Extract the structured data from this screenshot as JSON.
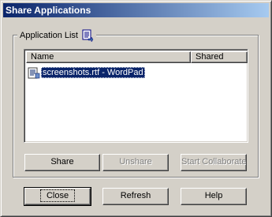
{
  "window": {
    "title": "Share Applications"
  },
  "group": {
    "label": "Application List",
    "icon": "shared-list-icon"
  },
  "list": {
    "columns": [
      "Name",
      "Shared"
    ],
    "rows": [
      {
        "name": "screenshots.rtf - WordPad",
        "shared": "",
        "selected": true,
        "icon": "wordpad-document-icon"
      }
    ]
  },
  "list_buttons": {
    "share": "Share",
    "unshare": "Unshare",
    "start_collaborate": "Start Collaborate"
  },
  "dialog_buttons": {
    "close": "Close",
    "refresh": "Refresh",
    "help": "Help"
  },
  "colors": {
    "titlebar": "#0a246a",
    "titlebar_gradient_end": "#a6caf0",
    "dialog_face": "#d4d0c8",
    "selection": "#0a246a"
  }
}
